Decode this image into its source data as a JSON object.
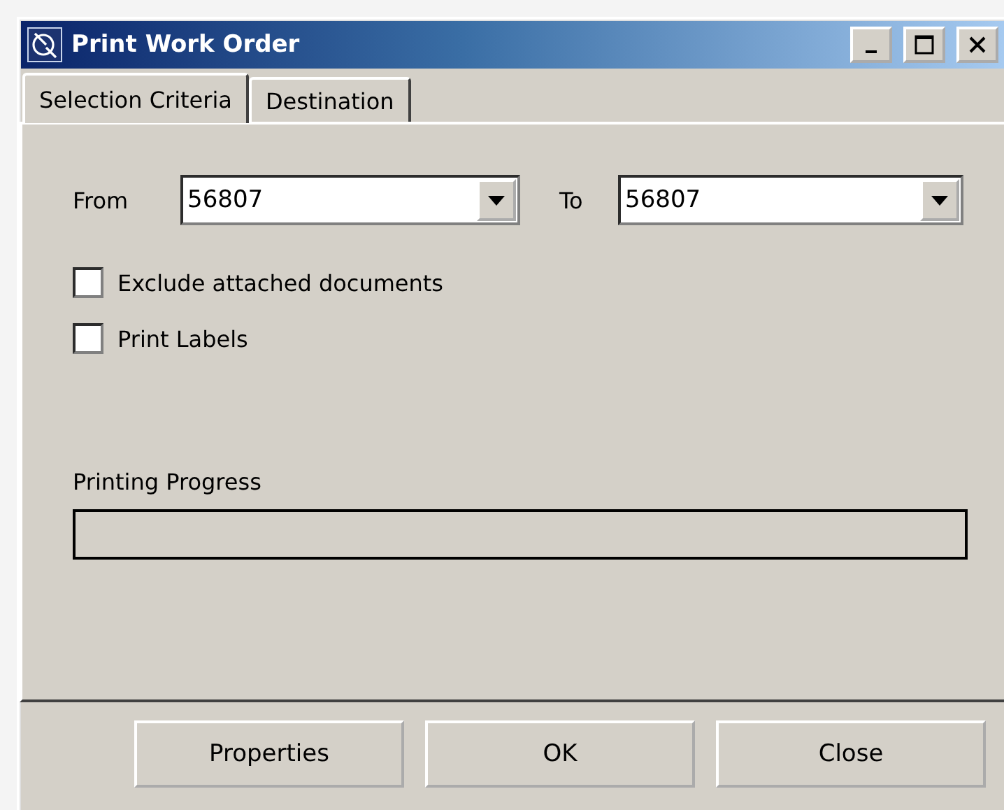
{
  "window": {
    "title": "Print Work Order"
  },
  "tabs": [
    {
      "label": "Selection Criteria",
      "selected": true
    },
    {
      "label": "Destination",
      "selected": false
    }
  ],
  "range": {
    "from_label": "From",
    "from_value": "56807",
    "to_label": "To",
    "to_value": "56807"
  },
  "options": [
    {
      "label": "Exclude attached documents",
      "checked": false
    },
    {
      "label": "Print Labels",
      "checked": false
    }
  ],
  "progress": {
    "label": "Printing Progress",
    "level": 0
  },
  "buttons": [
    "Properties",
    "OK",
    "Close"
  ]
}
